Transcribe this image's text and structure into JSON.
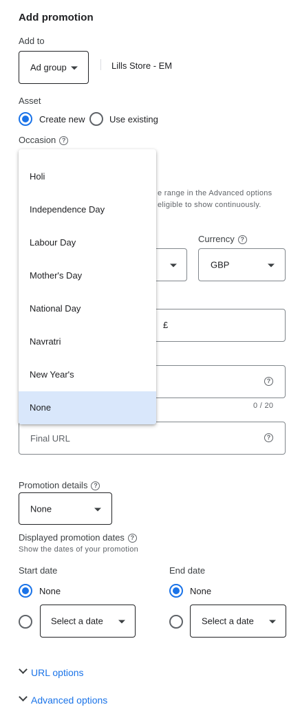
{
  "header": {
    "title": "Add promotion"
  },
  "add_to": {
    "label": "Add to",
    "selected": "Ad group",
    "target": "Lills Store - EM"
  },
  "asset": {
    "label": "Asset",
    "options": [
      {
        "label": "Create new",
        "selected": true
      },
      {
        "label": "Use existing",
        "selected": false
      }
    ]
  },
  "occasion": {
    "label": "Occasion",
    "help_icon": "help-circle-icon",
    "menu": [
      "Holi",
      "Independence Day",
      "Labour Day",
      "Mother's Day",
      "National Day",
      "Navratri",
      "New Year's",
      "None"
    ],
    "selected": "None"
  },
  "occasion_hint": {
    "line1": "e range in the Advanced options",
    "line2": "eligible to show continuously."
  },
  "currency": {
    "label": "Currency",
    "selected": "GBP"
  },
  "amount_prefix": "£",
  "item_char_count": "0 / 20",
  "final_url": {
    "placeholder": "Final URL"
  },
  "promotion_details": {
    "label": "Promotion details",
    "selected": "None"
  },
  "displayed_dates": {
    "label": "Displayed promotion dates",
    "subtitle": "Show the dates of your promotion"
  },
  "start_date": {
    "label": "Start date",
    "none_label": "None",
    "none_selected": true,
    "select_label": "Select a date"
  },
  "end_date": {
    "label": "End date",
    "none_label": "None",
    "none_selected": true,
    "select_label": "Select a date"
  },
  "links": {
    "url_options": "URL options",
    "advanced_options": "Advanced options"
  },
  "colors": {
    "accent": "#1a73e8",
    "selected_bg": "#d9e7fb",
    "text": "#202124",
    "muted": "#5f6368"
  }
}
